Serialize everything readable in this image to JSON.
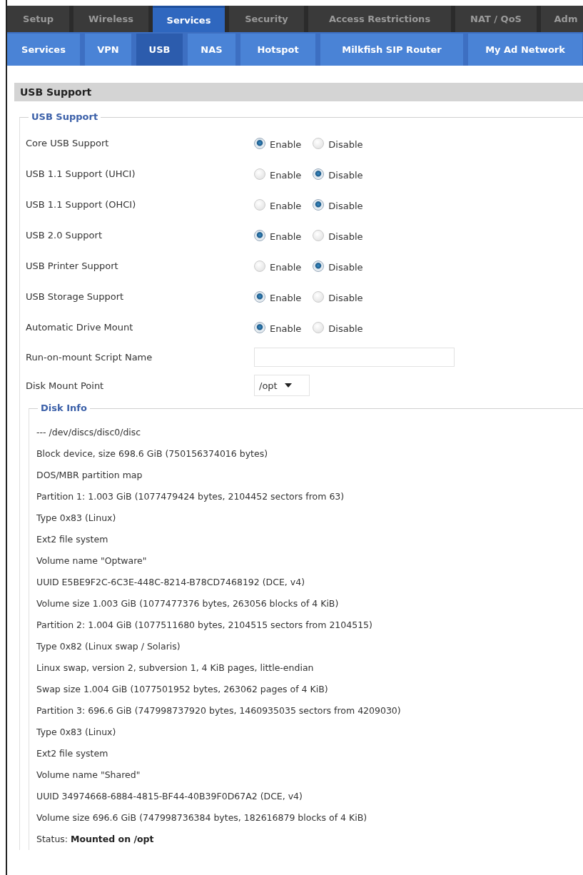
{
  "tabs": [
    {
      "label": "Setup",
      "selected": false
    },
    {
      "label": "Wireless",
      "selected": false
    },
    {
      "label": "Services",
      "selected": true
    },
    {
      "label": "Security",
      "selected": false
    },
    {
      "label": "Access Restrictions",
      "selected": false
    },
    {
      "label": "NAT / QoS",
      "selected": false
    },
    {
      "label": "Adm",
      "selected": false
    }
  ],
  "subtabs": [
    {
      "label": "Services",
      "selected": false
    },
    {
      "label": "VPN",
      "selected": false
    },
    {
      "label": "USB",
      "selected": true
    },
    {
      "label": "NAS",
      "selected": false
    },
    {
      "label": "Hotspot",
      "selected": false
    },
    {
      "label": "Milkfish SIP Router",
      "selected": false
    },
    {
      "label": "My Ad Network",
      "selected": false
    }
  ],
  "section_title": "USB Support",
  "fieldset_legend": "USB Support",
  "settings": [
    {
      "kind": "radio",
      "label": "Core USB Support",
      "options": [
        {
          "label": "Enable",
          "selected": true
        },
        {
          "label": "Disable",
          "selected": false
        }
      ]
    },
    {
      "kind": "radio",
      "label": "USB 1.1 Support (UHCI)",
      "options": [
        {
          "label": "Enable",
          "selected": false
        },
        {
          "label": "Disable",
          "selected": true
        }
      ]
    },
    {
      "kind": "radio",
      "label": "USB 1.1 Support (OHCI)",
      "options": [
        {
          "label": "Enable",
          "selected": false
        },
        {
          "label": "Disable",
          "selected": true
        }
      ]
    },
    {
      "kind": "radio",
      "label": "USB 2.0 Support",
      "options": [
        {
          "label": "Enable",
          "selected": true
        },
        {
          "label": "Disable",
          "selected": false
        }
      ]
    },
    {
      "kind": "radio",
      "label": "USB Printer Support",
      "options": [
        {
          "label": "Enable",
          "selected": false
        },
        {
          "label": "Disable",
          "selected": true
        }
      ]
    },
    {
      "kind": "radio",
      "label": "USB Storage Support",
      "options": [
        {
          "label": "Enable",
          "selected": true
        },
        {
          "label": "Disable",
          "selected": false
        }
      ]
    },
    {
      "kind": "radio",
      "label": "Automatic Drive Mount",
      "options": [
        {
          "label": "Enable",
          "selected": true
        },
        {
          "label": "Disable",
          "selected": false
        }
      ]
    },
    {
      "kind": "text",
      "label": "Run-on-mount Script Name"
    },
    {
      "kind": "select",
      "label": "Disk Mount Point",
      "value": "/opt"
    }
  ],
  "disk_info": {
    "legend": "Disk Info",
    "lines": [
      "--- /dev/discs/disc0/disc",
      "Block device, size 698.6 GiB (750156374016 bytes)",
      "DOS/MBR partition map",
      "Partition 1: 1.003 GiB (1077479424 bytes, 2104452 sectors from 63)",
      "Type 0x83 (Linux)",
      "Ext2 file system",
      "Volume name \"Optware\"",
      "UUID E5BE9F2C-6C3E-448C-8214-B78CD7468192 (DCE, v4)",
      "Volume size 1.003 GiB (1077477376 bytes, 263056 blocks of 4 KiB)",
      "Partition 2: 1.004 GiB (1077511680 bytes, 2104515 sectors from 2104515)",
      "Type 0x82 (Linux swap / Solaris)",
      "Linux swap, version 2, subversion 1, 4 KiB pages, little-endian",
      "Swap size 1.004 GiB (1077501952 bytes, 263062 pages of 4 KiB)",
      "Partition 3: 696.6 GiB (747998737920 bytes, 1460935035 sectors from 4209030)",
      "Type 0x83 (Linux)",
      "Ext2 file system",
      "Volume name \"Shared\"",
      "UUID 34974668-6884-4815-BF44-40B39F0D67A2 (DCE, v4)",
      "Volume size 696.6 GiB (747998736384 bytes, 182616879 blocks of 4 KiB)",
      "Status: **Mounted on /opt**"
    ]
  }
}
